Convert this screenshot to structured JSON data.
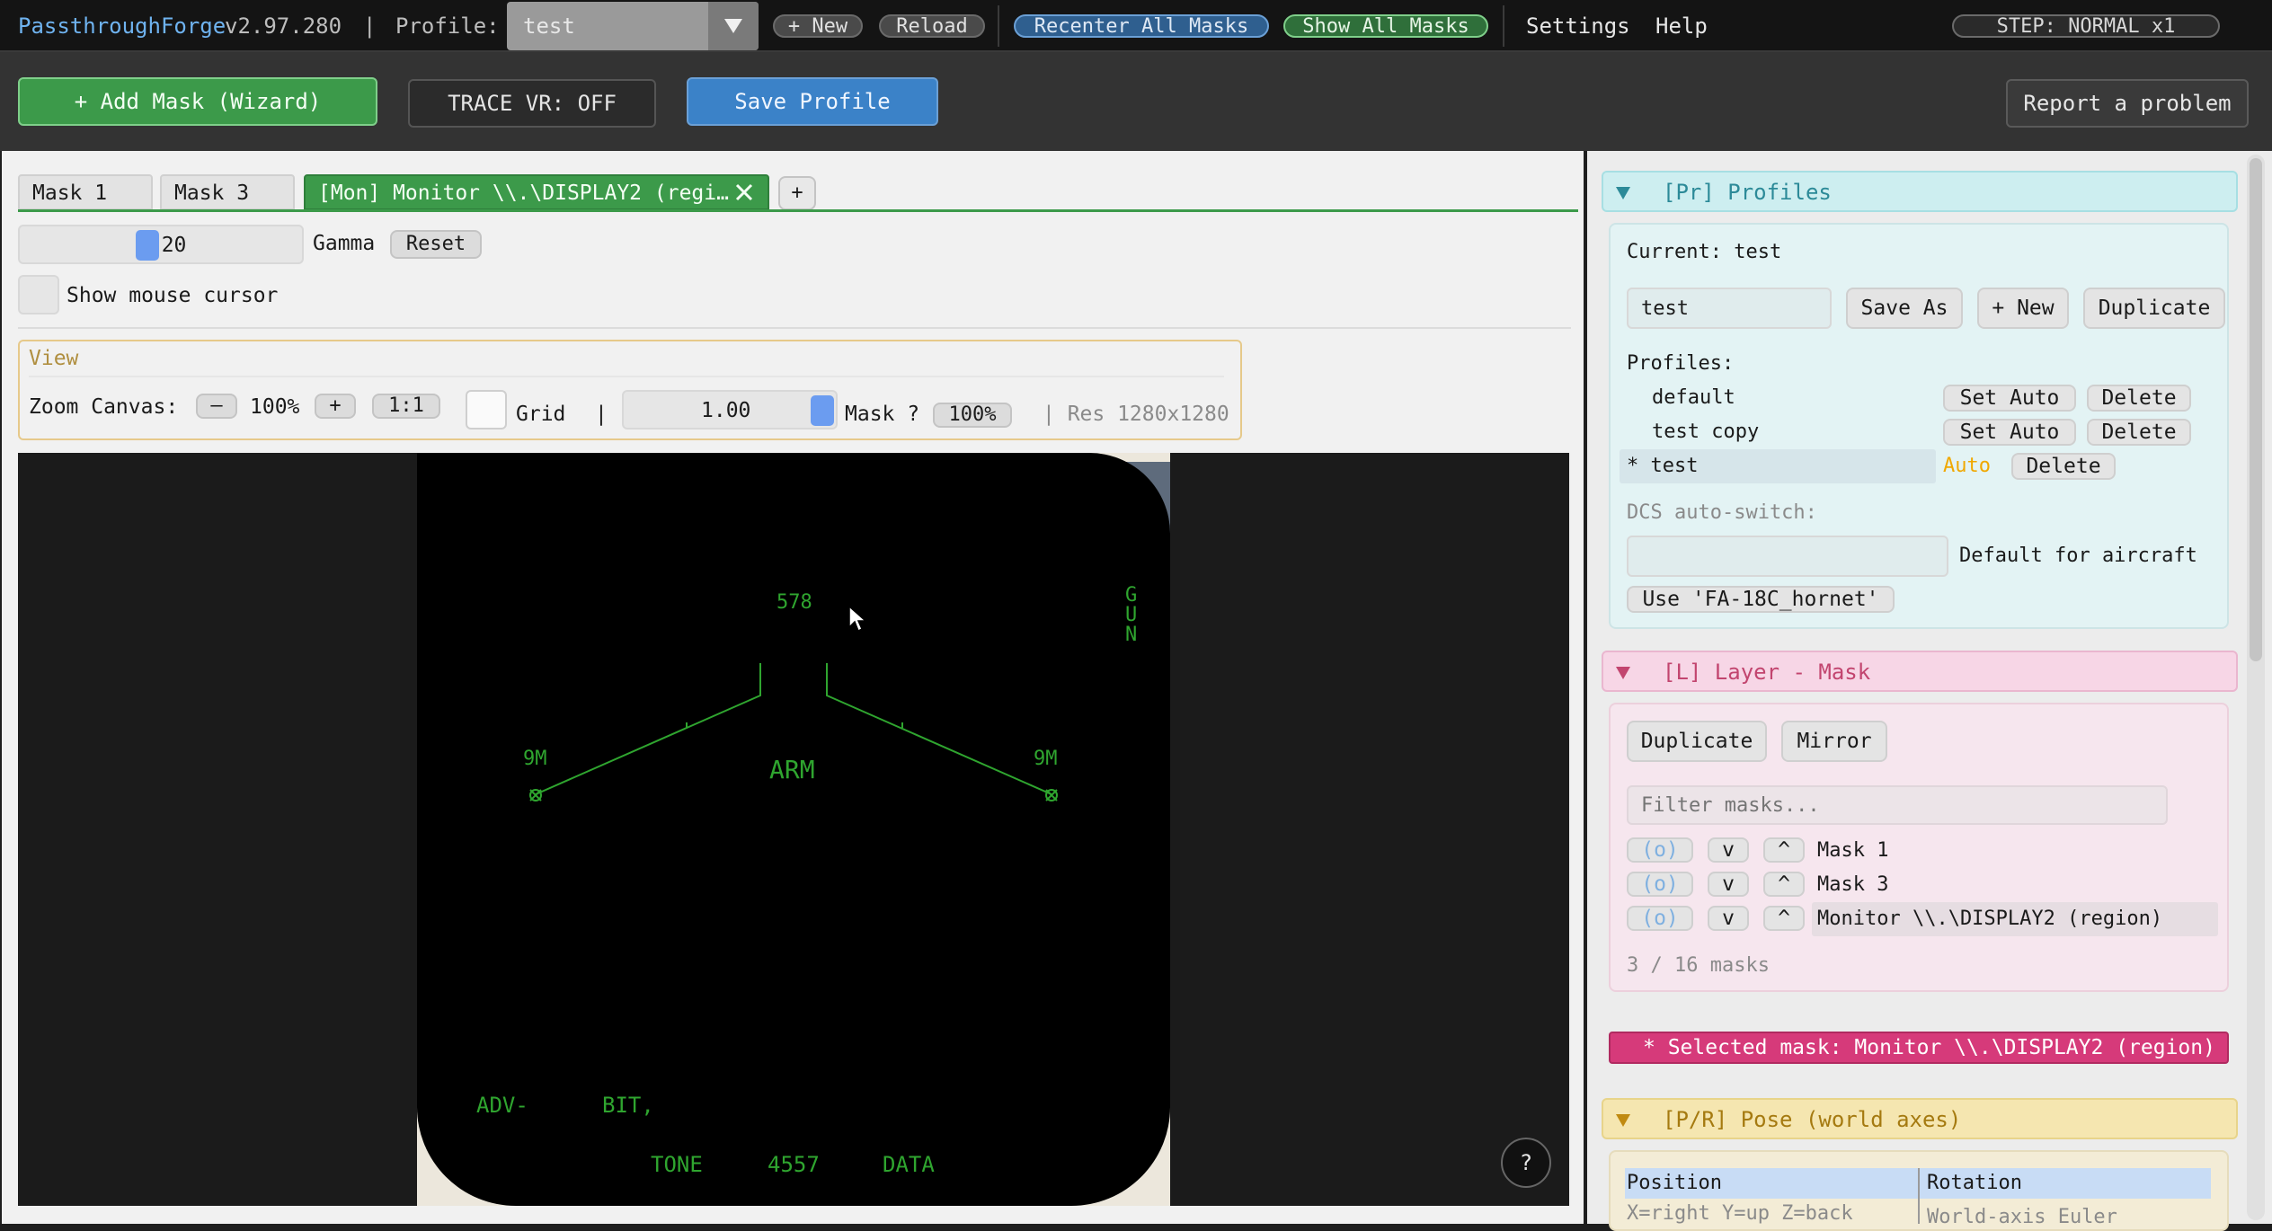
{
  "menubar": {
    "app_name": "PassthroughForge",
    "version": "v2.97.280",
    "separator": "|",
    "profile_label": "Profile:",
    "profile_value": "test",
    "new_label": "+ New",
    "reload_label": "Reload",
    "recenter_label": "Recenter All Masks",
    "show_all_label": "Show All Masks",
    "settings_label": "Settings",
    "help_label": "Help",
    "step_label": "STEP: NORMAL  x1"
  },
  "toolbar": {
    "add_mask_label": "+  Add Mask  (Wizard)",
    "trace_label": "TRACE VR: OFF",
    "save_profile_label": "Save Profile",
    "report_label": "Report a problem"
  },
  "tabs": [
    {
      "label": "Mask 1"
    },
    {
      "label": "Mask 3"
    },
    {
      "label": "[Mon] Monitor \\\\.\\DISPLAY2 (regi…"
    }
  ],
  "tab_add_label": "+",
  "gamma": {
    "value": "2.20",
    "label": "Gamma",
    "reset_label": "Reset",
    "level": 0.44
  },
  "show_cursor_label": "Show mouse cursor",
  "view": {
    "title": "View",
    "zoom_label": "Zoom Canvas:",
    "minus_label": "–",
    "zoom_value": "100%",
    "plus_label": "+",
    "one_to_one_label": "1:1",
    "grid_label": "Grid",
    "sep": "|",
    "mask_value": "1.00",
    "mask_label": "Mask ?",
    "mask_pct": "100%",
    "res_label": "| Res 1280x1280"
  },
  "hud": {
    "speed": "578",
    "gun": "G\nU\nN",
    "left_9m": "9M",
    "right_9m": "9M",
    "arm": "ARM",
    "adv": "ADV-",
    "bit": "BIT,",
    "tone": "TONE",
    "code": "4557",
    "data": "DATA"
  },
  "help_button": "?",
  "profiles": {
    "header": "[Pr] Profiles",
    "current_label": "Current: test",
    "name_field": "test",
    "save_as_label": "Save As",
    "new_label": "+ New",
    "duplicate_label": "Duplicate",
    "list_label": "Profiles:",
    "items": [
      {
        "name": "default",
        "auto_label": "Set Auto",
        "delete_label": "Delete"
      },
      {
        "name": "test copy",
        "auto_label": "Set Auto",
        "delete_label": "Delete"
      },
      {
        "name": "* test",
        "auto_label": "Auto",
        "delete_label": "Delete"
      }
    ],
    "dcs_label": "DCS auto-switch:",
    "default_aircraft_label": "Default for aircraft",
    "use_label": "Use 'FA-18C_hornet'"
  },
  "layer": {
    "header": "[L] Layer - Mask",
    "duplicate_label": "Duplicate",
    "mirror_label": "Mirror",
    "filter_placeholder": "Filter masks...",
    "items": [
      {
        "vis": "(o)",
        "down": "v",
        "up": "^",
        "name": "Mask 1"
      },
      {
        "vis": "(o)",
        "down": "v",
        "up": "^",
        "name": "Mask 3"
      },
      {
        "vis": "(o)",
        "down": "v",
        "up": "^",
        "name": "Monitor \\\\.\\DISPLAY2 (region)"
      }
    ],
    "count_label": "3 / 16 masks",
    "selected_label": "*  Selected mask:  Monitor \\\\.\\DISPLAY2 (region)"
  },
  "pose": {
    "header": "[P/R] Pose (world axes)",
    "position_label": "Position",
    "rotation_label": "Rotation",
    "position_hint": "X=right Y=up Z=back",
    "rotation_hint": "World-axis Euler"
  },
  "colors": {
    "accent_blue": "#3b82c8",
    "green": "#3c9a4a",
    "hud_green": "#2fa52f",
    "profiles_bg": "#cdeef0",
    "layer_bg": "#f7d6e6",
    "selected_bg": "#d63a7a",
    "pose_bg": "#f5e6b0"
  }
}
